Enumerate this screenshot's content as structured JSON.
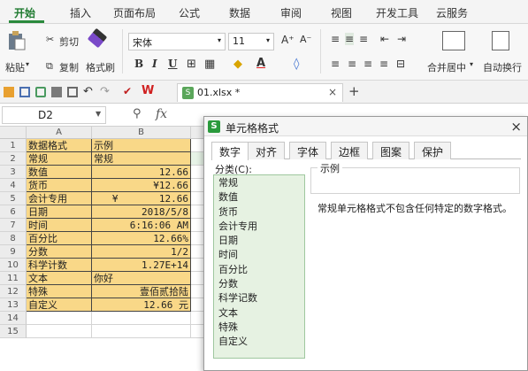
{
  "colors": {
    "accent": "#2a8a3c",
    "highlight": "#f9d888",
    "category_bg": "#e6f2e2"
  },
  "menu": {
    "tabs": [
      "开始",
      "插入",
      "页面布局",
      "公式",
      "数据",
      "审阅",
      "视图",
      "开发工具",
      "云服务"
    ]
  },
  "toolbar": {
    "paste": "粘贴",
    "cut": "剪切",
    "copy": "复制",
    "format_painter": "格式刷",
    "font_name": "宋体",
    "font_size": "11",
    "grow_font": "A⁺",
    "shrink_font": "A⁻",
    "merge_center": "合并居中",
    "wrap_text": "自动换行",
    "bold": "B",
    "italic": "I",
    "underline": "U"
  },
  "quickbar": {
    "file_name": "01.xlsx *"
  },
  "formula_bar": {
    "name_box": "D2",
    "fx_label": "fx"
  },
  "sheet": {
    "col_a": "A",
    "col_b": "B",
    "rows": [
      {
        "n": "1",
        "a": "数据格式",
        "b": "示例"
      },
      {
        "n": "2",
        "a": "常规",
        "b": "常规"
      },
      {
        "n": "3",
        "a": "数值",
        "b": "12.66"
      },
      {
        "n": "4",
        "a": "货币",
        "b": "¥12.66"
      },
      {
        "n": "5",
        "a": "会计专用",
        "b": "¥       12.66"
      },
      {
        "n": "6",
        "a": "日期",
        "b": "2018/5/8"
      },
      {
        "n": "7",
        "a": "时间",
        "b": "6:16:06 AM"
      },
      {
        "n": "8",
        "a": "百分比",
        "b": "12.66%"
      },
      {
        "n": "9",
        "a": "分数",
        "b": "1/2"
      },
      {
        "n": "10",
        "a": "科学计数",
        "b": "1.27E+14"
      },
      {
        "n": "11",
        "a": "文本",
        "b": "你好"
      },
      {
        "n": "12",
        "a": "特殊",
        "b": "壹佰贰拾陆"
      },
      {
        "n": "13",
        "a": "自定义",
        "b": "12.66 元"
      },
      {
        "n": "14",
        "a": "",
        "b": ""
      },
      {
        "n": "15",
        "a": "",
        "b": ""
      }
    ]
  },
  "dialog": {
    "title": "单元格格式",
    "tabs": [
      "数字",
      "对齐",
      "字体",
      "边框",
      "图案",
      "保护"
    ],
    "category_label": "分类(C):",
    "categories": [
      "常规",
      "数值",
      "货币",
      "会计专用",
      "日期",
      "时间",
      "百分比",
      "分数",
      "科学记数",
      "文本",
      "特殊",
      "自定义"
    ],
    "example_label": "示例",
    "description": "常规单元格格式不包含任何特定的数字格式。"
  }
}
